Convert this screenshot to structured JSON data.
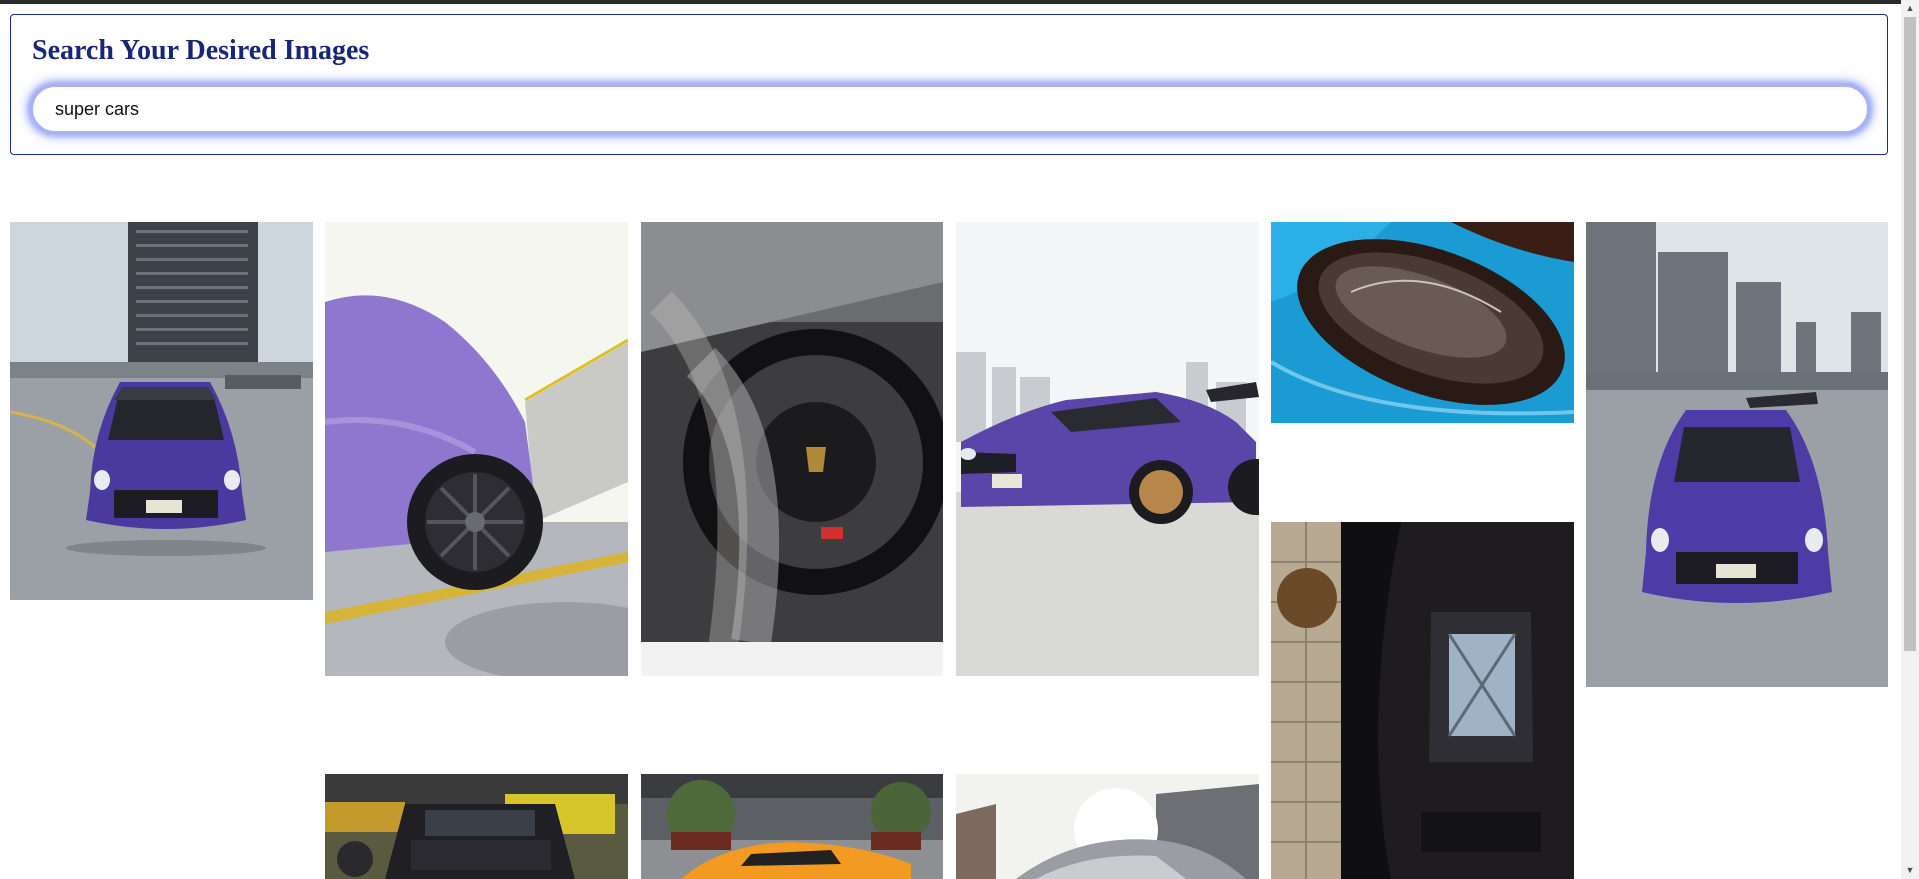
{
  "header": {
    "title": "Search Your Desired Images"
  },
  "search": {
    "value": "super cars"
  },
  "gallery": {
    "images": [
      {
        "name": "purple-gtr-front-rooftop"
      },
      {
        "name": "purple-car-side-wheel"
      },
      {
        "name": "steering-wheel-interior"
      },
      {
        "name": "purple-gtr-widebody"
      },
      {
        "name": "blue-car-headlight"
      },
      {
        "name": "purple-gtr-front-city"
      },
      {
        "name": "black-car-engine-cover-topdown"
      },
      {
        "name": "dark-suv-car-show"
      },
      {
        "name": "orange-lamborghini"
      },
      {
        "name": "car-sunlight"
      }
    ]
  },
  "scrollbar": {
    "up_arrow": "▲",
    "down_arrow": "▼"
  }
}
